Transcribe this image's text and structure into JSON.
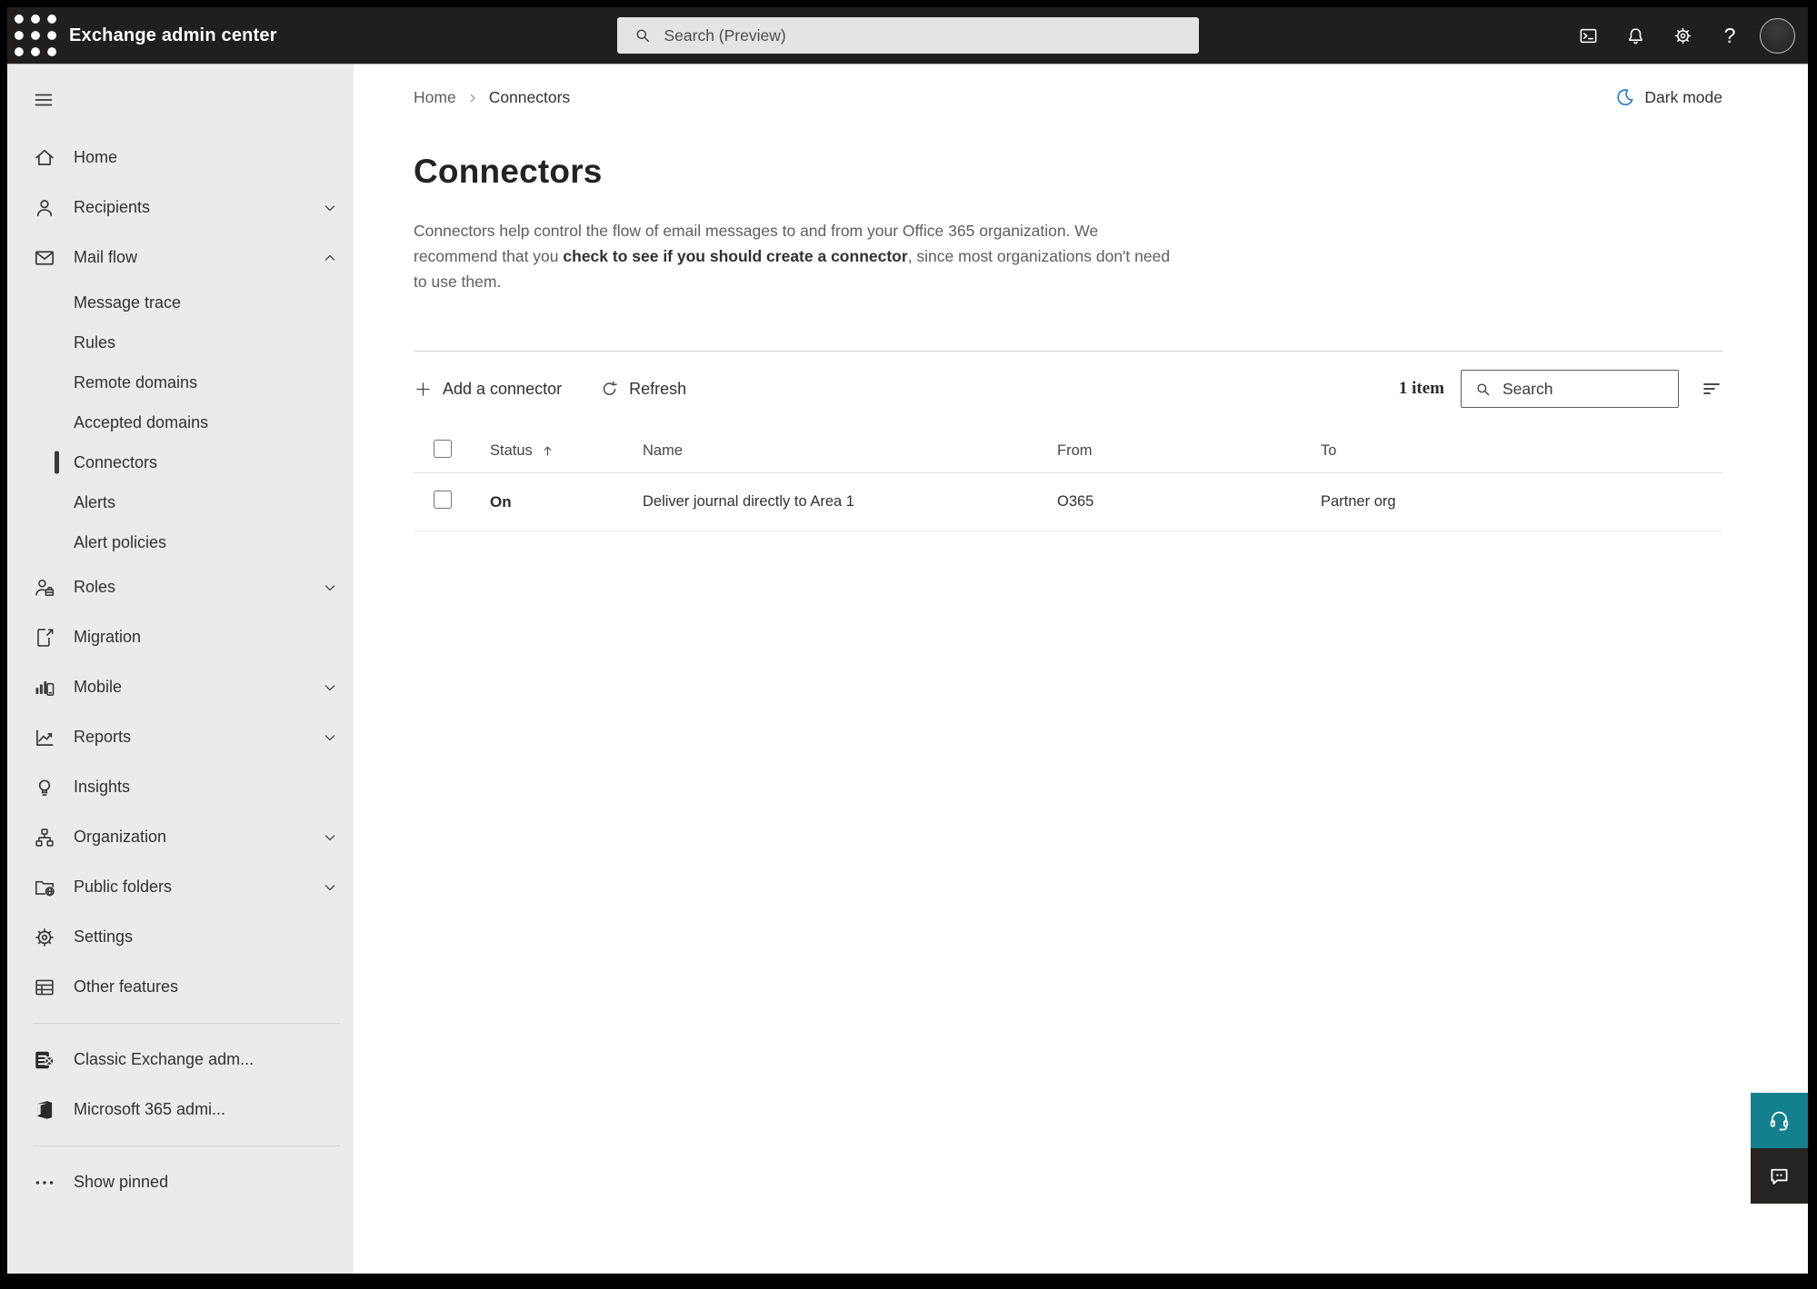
{
  "topbar": {
    "title": "Exchange admin center",
    "search_placeholder": "Search (Preview)"
  },
  "sidebar": {
    "items": [
      {
        "id": "home",
        "label": "Home",
        "icon": "home"
      },
      {
        "id": "recipients",
        "label": "Recipients",
        "icon": "person",
        "chevron": "down"
      },
      {
        "id": "mail-flow",
        "label": "Mail flow",
        "icon": "mail",
        "chevron": "up"
      },
      {
        "id": "message-trace",
        "label": "Message trace",
        "sub": true
      },
      {
        "id": "rules",
        "label": "Rules",
        "sub": true
      },
      {
        "id": "remote-domains",
        "label": "Remote domains",
        "sub": true
      },
      {
        "id": "accepted-domains",
        "label": "Accepted domains",
        "sub": true
      },
      {
        "id": "connectors",
        "label": "Connectors",
        "sub": true,
        "selected": true
      },
      {
        "id": "alerts",
        "label": "Alerts",
        "sub": true
      },
      {
        "id": "alert-policies",
        "label": "Alert policies",
        "sub": true
      },
      {
        "id": "roles",
        "label": "Roles",
        "icon": "person-badge",
        "chevron": "down"
      },
      {
        "id": "migration",
        "label": "Migration",
        "icon": "doc-arrow"
      },
      {
        "id": "mobile",
        "label": "Mobile",
        "icon": "mobile-chart",
        "chevron": "down"
      },
      {
        "id": "reports",
        "label": "Reports",
        "icon": "chart-line",
        "chevron": "down"
      },
      {
        "id": "insights",
        "label": "Insights",
        "icon": "bulb"
      },
      {
        "id": "organization",
        "label": "Organization",
        "icon": "org",
        "chevron": "down"
      },
      {
        "id": "public-folders",
        "label": "Public folders",
        "icon": "folder-globe",
        "chevron": "down"
      },
      {
        "id": "settings",
        "label": "Settings",
        "icon": "gear"
      },
      {
        "id": "other-features",
        "label": "Other features",
        "icon": "table-grid"
      },
      {
        "type": "divider"
      },
      {
        "id": "classic-exchange-admin",
        "label": "Classic Exchange adm...",
        "icon": "exchange-logo"
      },
      {
        "id": "microsoft-365-admin",
        "label": "Microsoft 365 admi...",
        "icon": "office-logo"
      },
      {
        "type": "divider"
      },
      {
        "id": "show-pinned",
        "label": "Show pinned",
        "icon": "dots"
      }
    ]
  },
  "page_header": {
    "breadcrumb": [
      "Home",
      "Connectors"
    ],
    "dark_mode_label": "Dark mode",
    "title": "Connectors",
    "description": {
      "part1": "Connectors help control the flow of email messages to and from your Office 365 organization. We recommend that you ",
      "link_text": "check to see if you should create a connector",
      "part2": ", since most organizations don't need to use them."
    }
  },
  "toolbar": {
    "add_label": "Add a connector",
    "refresh_label": "Refresh",
    "item_count": "1 item",
    "search_placeholder": "Search"
  },
  "table": {
    "columns": [
      "Status",
      "Name",
      "From",
      "To"
    ],
    "rows": [
      {
        "status": "On",
        "name": "Deliver journal directly to Area 1",
        "from": "O365",
        "to": "Partner org"
      }
    ]
  },
  "icons": {
    "hamburger": "menu-lines",
    "waffle": "app-launcher-grid",
    "moon": "dark-mode-crescent",
    "sort": "arrow-up"
  },
  "colors": {
    "topbar_bg": "#201f1e",
    "sidebar_bg": "#ebebeb",
    "accent_blue": "#2b7cd3",
    "support_teal": "#13808d",
    "feedback_dark": "#252423",
    "selected_indicator": "#3b3a39"
  }
}
